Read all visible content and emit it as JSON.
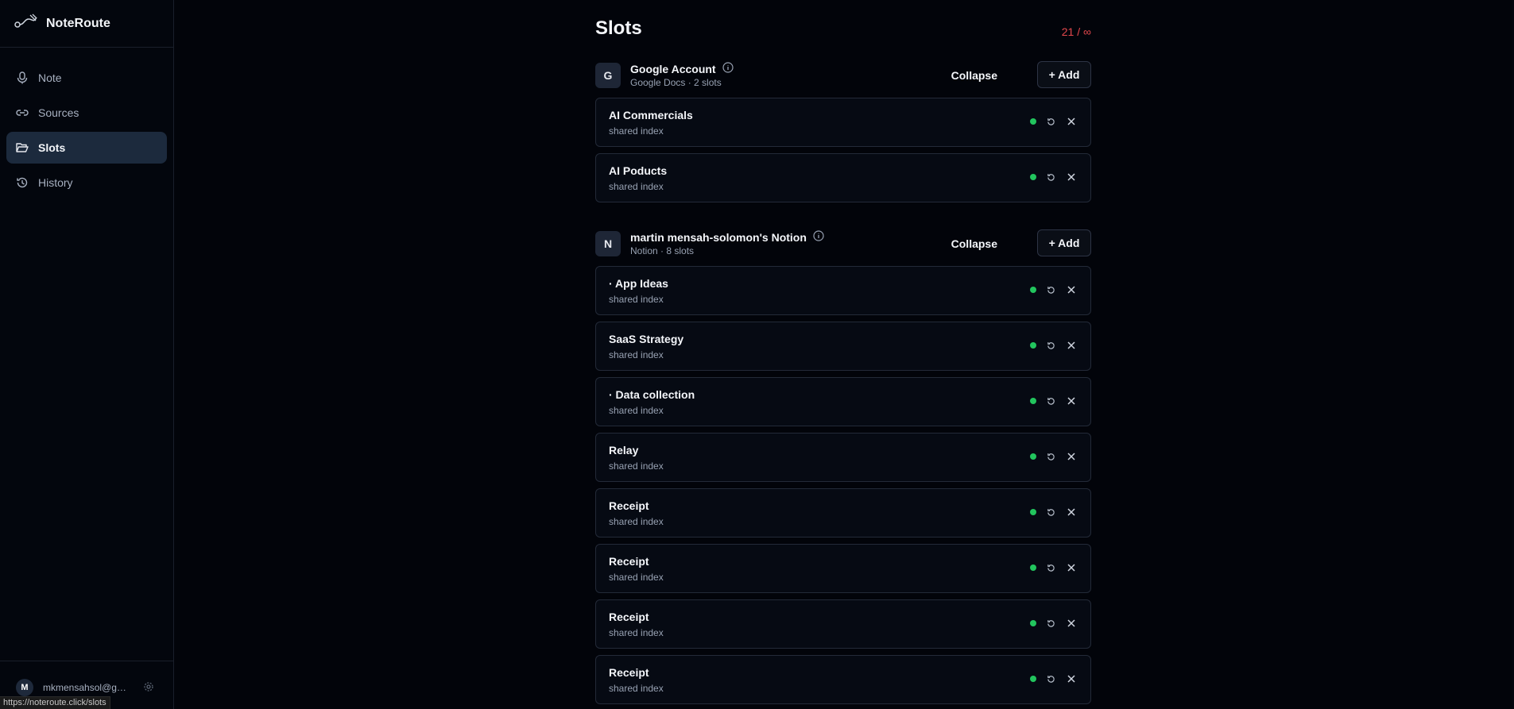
{
  "app": {
    "name": "NoteRoute"
  },
  "nav": [
    {
      "label": "Note",
      "icon": "microphone-icon"
    },
    {
      "label": "Sources",
      "icon": "link-icon"
    },
    {
      "label": "Slots",
      "icon": "folder-open-icon",
      "active": true
    },
    {
      "label": "History",
      "icon": "history-icon"
    }
  ],
  "user": {
    "initial": "M",
    "email": "mkmensahsol@gm..."
  },
  "status_url": "https://noteroute.click/slots",
  "page": {
    "title": "Slots",
    "counter": "21 / ∞"
  },
  "groups": [
    {
      "badge": "G",
      "title": "Google Account",
      "subtitle": "Google Docs · 2 slots",
      "collapse_label": "Collapse",
      "add_label": "+ Add",
      "slots": [
        {
          "name": "AI Commercials",
          "sub": "shared index"
        },
        {
          "name": "AI Poducts",
          "sub": "shared index"
        }
      ]
    },
    {
      "badge": "N",
      "title": "martin mensah-solomon's Notion",
      "subtitle": "Notion · 8 slots",
      "collapse_label": "Collapse",
      "add_label": "+ Add",
      "slots": [
        {
          "name": "· App Ideas",
          "sub": "shared index"
        },
        {
          "name": "SaaS Strategy",
          "sub": "shared index"
        },
        {
          "name": "· Data collection",
          "sub": "shared index"
        },
        {
          "name": "Relay",
          "sub": "shared index"
        },
        {
          "name": "Receipt",
          "sub": "shared index"
        },
        {
          "name": "Receipt",
          "sub": "shared index"
        },
        {
          "name": "Receipt",
          "sub": "shared index"
        },
        {
          "name": "Receipt",
          "sub": "shared index"
        }
      ]
    }
  ],
  "colors": {
    "accent_active": "#1c2a3d",
    "status_green": "#22c55e",
    "counter_red": "#e5484d"
  }
}
